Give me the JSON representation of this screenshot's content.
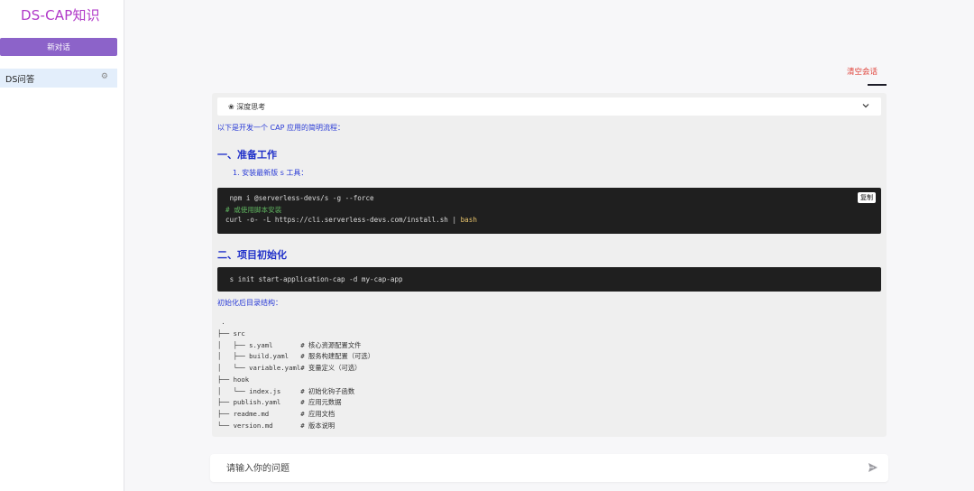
{
  "sidebar": {
    "title": "DS-CAP知识",
    "new_chat_label": "新对话",
    "sessions": [
      {
        "label": "DS问答",
        "icon": "gear-icon"
      }
    ]
  },
  "header": {
    "clear_label": "清空会话"
  },
  "message": {
    "think_label": "❀ 深度思考",
    "intro": "以下是开发一个 CAP 应用的简明流程：",
    "section1_title": "一、准备工作",
    "step1": "1. 安装最新版 s 工具：",
    "code1": {
      "line1": " npm i @serverless-devs/s -g --force",
      "line2": "# 或使用脚本安装",
      "line3_prefix": "curl -o- -L https://cli.serverless-devs.com/install.sh | ",
      "line3_bash": "bash",
      "copy_label": "复制"
    },
    "section2_title": "二、项目初始化",
    "code2": {
      "line1": " s init start-application-cap -d my-cap-app"
    },
    "tree_intro": "初始化后目录结构：",
    "tree": [
      " .",
      "├── src",
      "│   ├── s.yaml       # 核心资源配置文件",
      "│   ├── build.yaml   # 服务构建配置（可选）",
      "│   └── variable.yaml# 变量定义（可选）",
      "├── hook",
      "│   └── index.js     # 初始化钩子函数",
      "├── publish.yaml     # 应用元数据",
      "├── readme.md        # 应用文档",
      "└── version.md       # 版本说明"
    ]
  },
  "input": {
    "placeholder": "请输入你的问题"
  },
  "colors": {
    "accent": "#8c63c9",
    "title": "#b038c8",
    "clear": "#e0443c",
    "heading_blue": "#1f2fc9",
    "code_bg": "#1f1f1f"
  }
}
